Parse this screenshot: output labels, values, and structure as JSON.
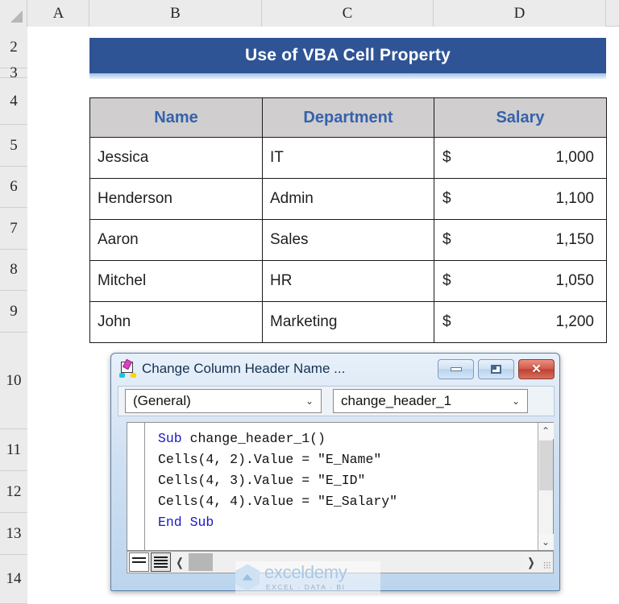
{
  "spreadsheet": {
    "column_headers": [
      "A",
      "B",
      "C",
      "D"
    ],
    "row_headers": [
      "2",
      "3",
      "4",
      "5",
      "6",
      "7",
      "8",
      "9",
      "10",
      "11",
      "12",
      "13",
      "14"
    ],
    "banner_title": "Use of VBA Cell Property",
    "banner_color": "#2F5496",
    "header_fill": "#D0CECE",
    "header_text_color": "#3462AD",
    "table": {
      "columns": [
        "Name",
        "Department",
        "Salary"
      ],
      "rows": [
        {
          "name": "Jessica",
          "department": "IT",
          "currency": "$",
          "salary": "1,000"
        },
        {
          "name": "Henderson",
          "department": "Admin",
          "currency": "$",
          "salary": "1,100"
        },
        {
          "name": "Aaron",
          "department": "Sales",
          "currency": "$",
          "salary": "1,150"
        },
        {
          "name": "Mitchel",
          "department": "HR",
          "currency": "$",
          "salary": "1,050"
        },
        {
          "name": "John",
          "department": "Marketing",
          "currency": "$",
          "salary": "1,200"
        }
      ]
    }
  },
  "vbe_window": {
    "title": "Change Column Header Name ...",
    "icon": "vba-module-icon",
    "buttons": {
      "minimize": "minimize-button",
      "maximize": "maximize-button",
      "close": "close-button",
      "close_glyph": "✕"
    },
    "object_combo": {
      "value": "(General)",
      "caret": "⌄"
    },
    "procedure_combo": {
      "value": "change_header_1",
      "caret": "⌄"
    },
    "code": {
      "line1_kw": "Sub",
      "line1_rest": " change_header_1()",
      "line2": "Cells(4, 2).Value = \"E_Name\"",
      "line3": "Cells(4, 3).Value = \"E_ID\"",
      "line4": "Cells(4, 4).Value = \"E_Salary\"",
      "line5_kw": "End Sub"
    },
    "vscrollbar": {
      "up": "⌃",
      "down": "⌄"
    },
    "hscrollbar": {
      "left": "❬",
      "right": "❭"
    }
  },
  "watermark": {
    "name": "exceldemy",
    "tagline": "EXCEL · DATA · BI"
  }
}
